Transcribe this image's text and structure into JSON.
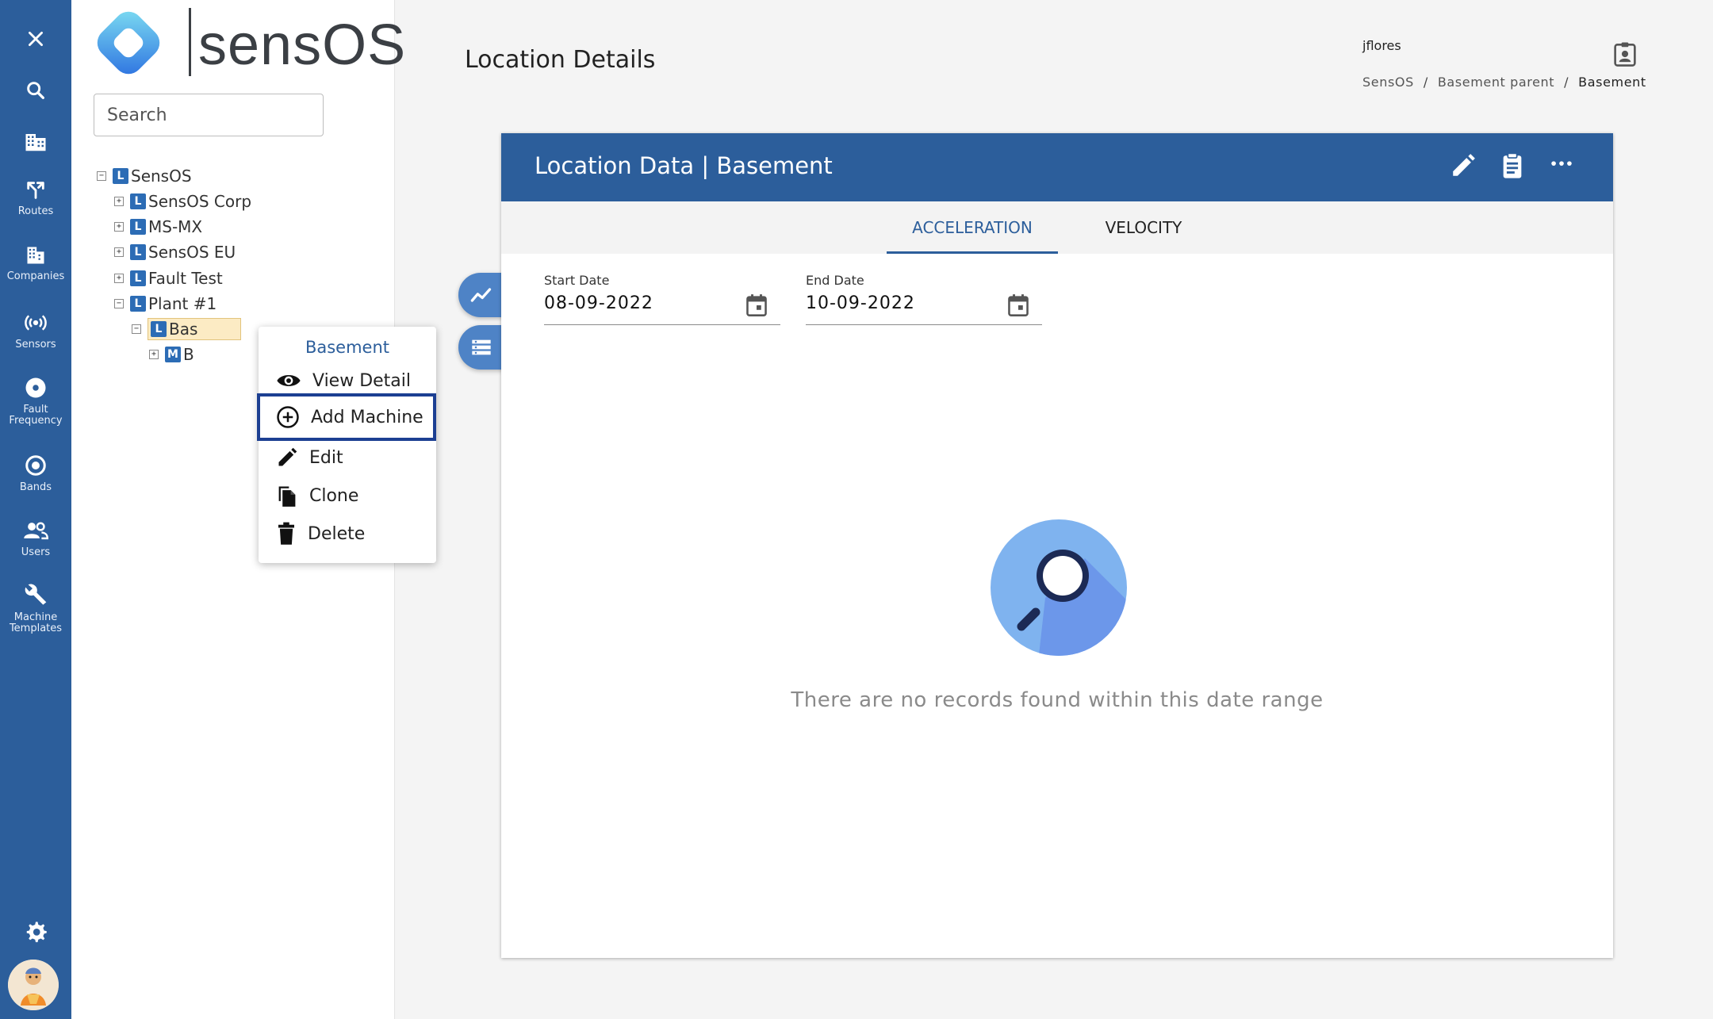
{
  "rail": {
    "items": [
      {
        "icon": "close-icon",
        "label": ""
      },
      {
        "icon": "search-icon",
        "label": ""
      },
      {
        "icon": "building-icon",
        "label": ""
      },
      {
        "icon": "routes-icon",
        "label": "Routes"
      },
      {
        "icon": "companies-icon",
        "label": "Companies"
      },
      {
        "icon": "sensors-icon",
        "label": "Sensors"
      },
      {
        "icon": "fault-frequency-icon",
        "label": "Fault Frequency"
      },
      {
        "icon": "bands-icon",
        "label": "Bands"
      },
      {
        "icon": "users-icon",
        "label": "Users"
      },
      {
        "icon": "wrench-icon",
        "label": "Machine Templates"
      }
    ],
    "settings_icon": "gear-icon",
    "rail_color": "#2c5e9b"
  },
  "logo": {
    "text": "sensOS"
  },
  "search": {
    "placeholder": "Search"
  },
  "tree": {
    "nodes": [
      {
        "label": "SensOS",
        "badge": "L"
      },
      {
        "label": "SensOS Corp",
        "badge": "L"
      },
      {
        "label": "MS-MX",
        "badge": "L"
      },
      {
        "label": "SensOS EU",
        "badge": "L"
      },
      {
        "label": "Fault Test",
        "badge": "L"
      },
      {
        "label": "Plant #1",
        "badge": "L"
      },
      {
        "label": "Bas",
        "badge": "L"
      },
      {
        "label": "B",
        "badge": "M"
      }
    ],
    "toggle_expanded": "−",
    "toggle_collapsed": "+"
  },
  "context_menu": {
    "title": "Basement",
    "items": [
      {
        "label": "View Detail",
        "icon": "eye-icon"
      },
      {
        "label": "Add Machine",
        "icon": "add-circle-icon"
      },
      {
        "label": "Edit",
        "icon": "pencil-icon"
      },
      {
        "label": "Clone",
        "icon": "copy-icon"
      },
      {
        "label": "Delete",
        "icon": "trash-icon"
      }
    ]
  },
  "header": {
    "page_title": "Location Details",
    "user_name": "jflores",
    "breadcrumb": [
      "SensOS",
      "Basement parent",
      "Basement"
    ],
    "breadcrumb_separator": "/"
  },
  "card": {
    "title": "Location Data | Basement",
    "tabs": [
      {
        "label": "ACCELERATION",
        "active": true
      },
      {
        "label": "VELOCITY",
        "active": false
      }
    ],
    "start_date": {
      "label": "Start Date",
      "value": "08-09-2022"
    },
    "end_date": {
      "label": "End Date",
      "value": "10-09-2022"
    },
    "empty_message": "There are no records found within this date range"
  },
  "colors": {
    "primary": "#2c5e9b",
    "fab": "#4e83c6",
    "focus_outline": "#1c3f92",
    "selected_node": "#fcebc4"
  }
}
